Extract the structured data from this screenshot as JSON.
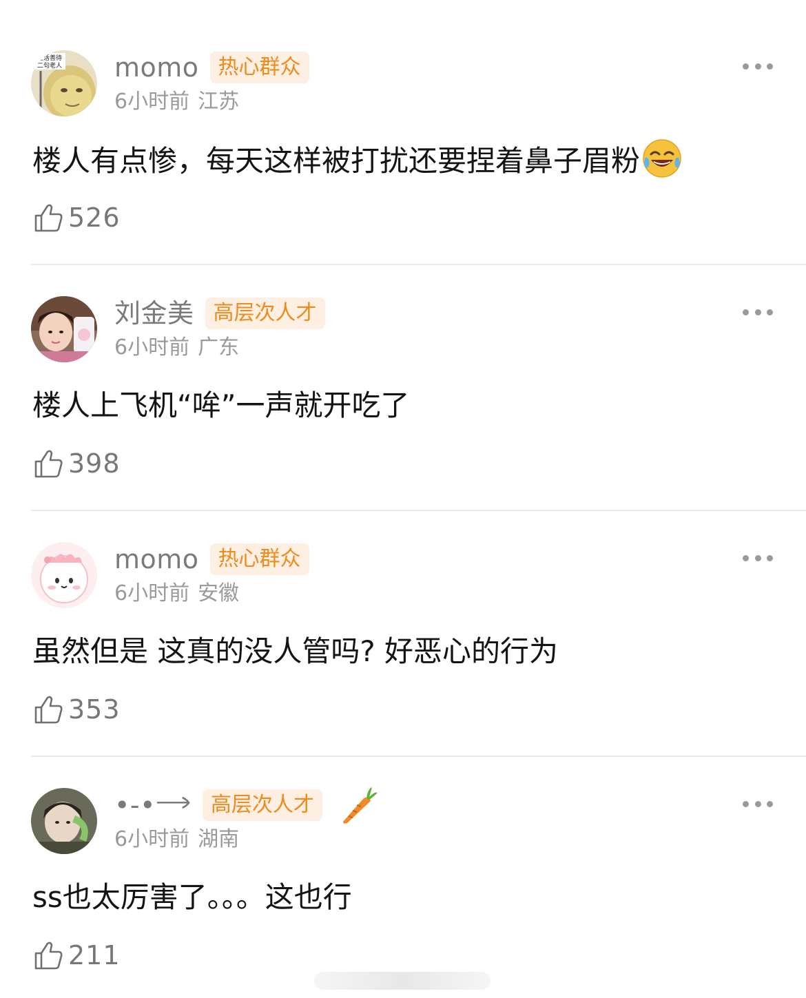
{
  "comments": [
    {
      "user": "momo",
      "badge": "热心群众",
      "time": "6小时前",
      "location": "江苏",
      "text": "楼人有点惨，每天这样被打扰还要捏着鼻子眉粉",
      "emoji": "laughing-tears-emoji",
      "likes": "526",
      "avatar_text": [
        "生活善待",
        "二句老人"
      ]
    },
    {
      "user": "刘金美",
      "badge": "高层次人才",
      "time": "6小时前",
      "location": "广东",
      "text": "楼人上飞机“哞”一声就开吃了",
      "likes": "398"
    },
    {
      "user": "momo",
      "badge": "热心群众",
      "time": "6小时前",
      "location": "安徽",
      "text": "虽然但是 这真的没人管吗? 好恶心的行为",
      "likes": "353"
    },
    {
      "user": "•-•𐃘",
      "badge": "高层次人才",
      "badge_icon": "carrot-icon",
      "time": "6小时前",
      "location": "湖南",
      "text": "ss也太厉害了。。。这也行",
      "likes": "211"
    }
  ],
  "colors": {
    "badge_bg": "#fdf0e3",
    "badge_text": "#f08a1c",
    "meta": "#9a9a9a",
    "name": "#7a7a7a",
    "divider": "#e9e9e9"
  }
}
